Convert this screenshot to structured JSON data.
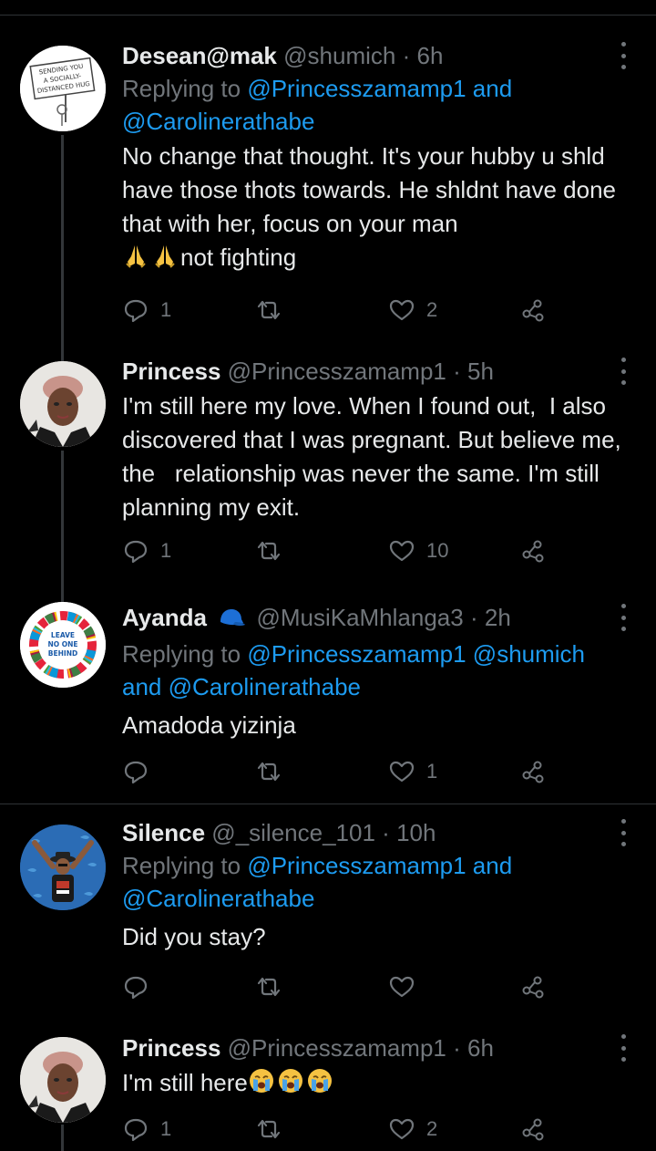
{
  "tweets": [
    {
      "name": "Desean@mak",
      "handle": "@shumich",
      "dot": "·",
      "time": "6h",
      "replying_prefix": "Replying to ",
      "mention_1": "@Princesszamamp1",
      "replying_and": " and",
      "mention_2": "@Carolinerathabe",
      "body_1": "No change that thought. It's your hubby u shld have those thots towards. He shldnt have done that with her, focus on your man",
      "body_2": "not fighting",
      "avatar_text_1": "SENDING YOU",
      "avatar_text_2": "A SOCIALLY-",
      "avatar_text_3": "DISTANCED HUG",
      "replies": "1",
      "likes": "2"
    },
    {
      "name": "Princess",
      "handle": "@Princesszamamp1",
      "dot": "·",
      "time": "5h",
      "body": "I'm still here my love. When I found out,  I also discovered that I was pregnant. But believe me,  the   relationship was never the same. I'm still planning my exit.",
      "replies": "1",
      "likes": "10"
    },
    {
      "name": "Ayanda",
      "handle": "@MusiKaMhlanga3",
      "dot": "·",
      "time": "2h",
      "replying_prefix": "Replying to ",
      "mention_1": "@Princesszamamp1",
      "mention_2": "@shumich",
      "replying_and": "and ",
      "mention_3": "@Carolinerathabe",
      "body": "Amadoda yizinja",
      "avatar_text_1": "LEAVE",
      "avatar_text_2": "NO ONE",
      "avatar_text_3": "BEHIND",
      "likes": "1"
    },
    {
      "name": "Silence",
      "handle": "@_silence_101",
      "dot": "·",
      "time": "10h",
      "replying_prefix": "Replying to ",
      "mention_1": "@Princesszamamp1",
      "replying_and": " and",
      "mention_2": "@Carolinerathabe",
      "body": "Did you stay?"
    },
    {
      "name": "Princess",
      "handle": "@Princesszamamp1",
      "dot": "·",
      "time": "6h",
      "body": "I'm still here",
      "replies": "1",
      "likes": "2"
    }
  ],
  "colors": {
    "background": "#000000",
    "text": "#e7e9ea",
    "muted": "#71767b",
    "link": "#1d9bf0",
    "divider": "#2f3336"
  },
  "icons": {
    "reply": "reply-icon",
    "retweet": "retweet-icon",
    "like": "like-icon",
    "share": "share-icon",
    "more": "more-options-icon",
    "badge": "blue-cap-badge-icon"
  }
}
